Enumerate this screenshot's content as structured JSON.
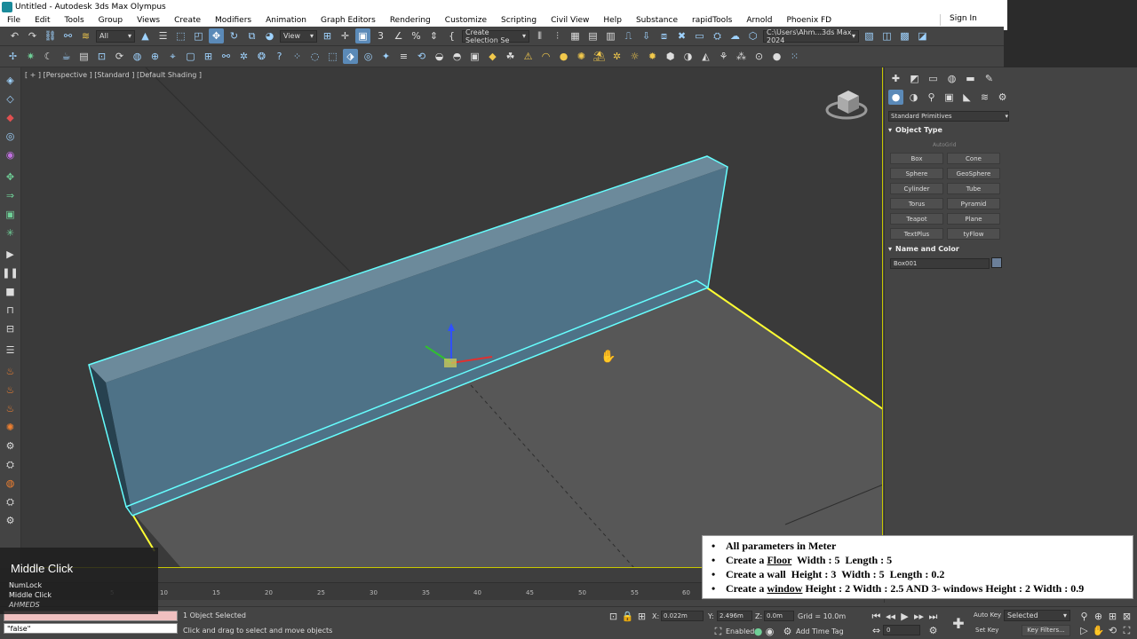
{
  "window": {
    "title": "Untitled - Autodesk 3ds Max Olympus",
    "sign_in": "Sign In"
  },
  "menu": [
    "File",
    "Edit",
    "Tools",
    "Group",
    "Views",
    "Create",
    "Modifiers",
    "Animation",
    "Graph Editors",
    "Rendering",
    "Customize",
    "Scripting",
    "Civil View",
    "Help",
    "Substance",
    "rapidTools",
    "Arnold",
    "Phoenix FD"
  ],
  "toolbar": {
    "filter_dropdown": "All",
    "view_dropdown": "View",
    "selection_set": "Create Selection Se",
    "project_path": "C:\\Users\\Ahm...3ds Max 2024"
  },
  "viewport": {
    "label": "[ + ] [Perspective ] [Standard ] [Default Shading ]",
    "colors": {
      "wall": "#4e7287",
      "wall_edge": "#66ffff",
      "floor_edge": "#ffff33",
      "floor": "#5a5a5a"
    }
  },
  "command_panel": {
    "category_dropdown": "Standard Primitives",
    "object_type_title": "Object Type",
    "autogrid": "AutoGrid",
    "primitives": [
      "Box",
      "Cone",
      "Sphere",
      "GeoSphere",
      "Cylinder",
      "Tube",
      "Torus",
      "Pyramid",
      "Teapot",
      "Plane",
      "TextPlus",
      "tyFlow"
    ],
    "name_color_title": "Name and Color",
    "object_name": "Box001"
  },
  "instructions": {
    "line1": "All parameters in Meter",
    "line2_pre": "Create a ",
    "line2_u": "Floor",
    "line2_post": "  Width : 5  Length : 5",
    "line3": "Create a wall  Height : 3  Width : 5  Length : 0.2",
    "line4_pre": "Create a ",
    "line4_u": "window",
    "line4_post": " Height : 2 Width : 2.5 AND 3- windows Height : 2 Width : 0.9"
  },
  "timeline": {
    "ticks": [
      "5",
      "10",
      "15",
      "20",
      "25",
      "30",
      "35",
      "40",
      "45",
      "50",
      "55",
      "60"
    ]
  },
  "overlay": {
    "title": "Middle Click",
    "line1": "NumLock",
    "line2": "Middle Click",
    "line3": "AHMEDS"
  },
  "status": {
    "maxscript": "\"false\"",
    "selection": "1 Object Selected",
    "prompt": "Click and drag to select and move objects",
    "x_label": "X:",
    "x_value": "0.022m",
    "y_label": "Y:",
    "y_value": "2.496m",
    "z_label": "Z:",
    "z_value": "0.0m",
    "grid": "Grid = 10.0m",
    "enabled": "Enabled:",
    "add_time_tag": "Add Time Tag",
    "auto_key": "Auto Key",
    "set_key": "Set Key",
    "selected_dropdown": "Selected",
    "key_filters": "Key Filters...",
    "frame": "0"
  }
}
